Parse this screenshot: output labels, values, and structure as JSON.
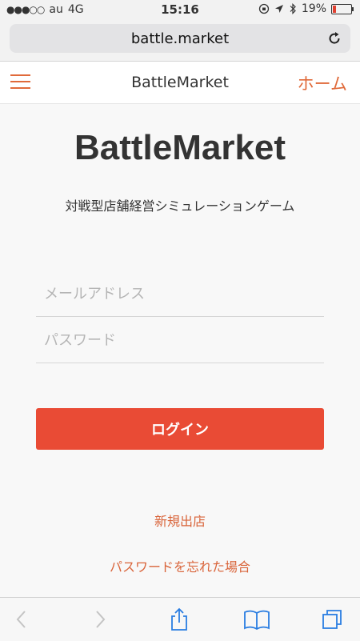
{
  "status_bar": {
    "signal": "●●●○○",
    "carrier": "au",
    "network": "4G",
    "time": "15:16",
    "battery_percent": "19%",
    "battery_level": 0.19
  },
  "browser": {
    "url": "battle.market"
  },
  "header": {
    "title": "BattleMarket",
    "home_label": "ホーム"
  },
  "main": {
    "logo": "BattleMarket",
    "subtitle": "対戦型店舗経営シミュレーションゲーム",
    "email_placeholder": "メールアドレス",
    "password_placeholder": "パスワード",
    "login_label": "ログイン",
    "new_store_label": "新規出店",
    "forgot_password_label": "パスワードを忘れた場合"
  },
  "colors": {
    "accent": "#e06a3a",
    "button": "#e94b35"
  }
}
